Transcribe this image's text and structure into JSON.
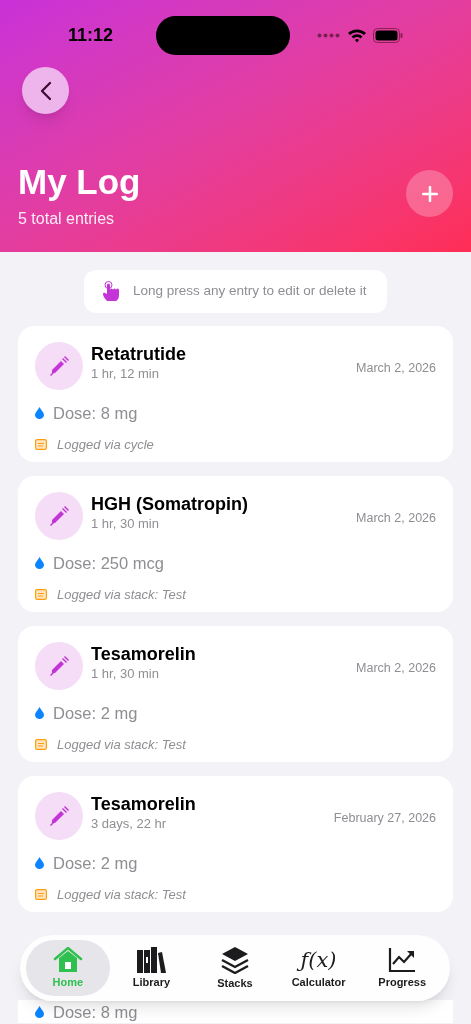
{
  "status_bar": {
    "time": "11:12"
  },
  "header": {
    "title": "My Log",
    "subtitle": "5 total entries"
  },
  "tip": "Long press any entry to edit or delete it",
  "entries": [
    {
      "name": "Retatrutide",
      "ago": "1 hr, 12 min",
      "date": "March 2, 2026",
      "dose": "Dose: 8 mg",
      "source": "Logged via cycle"
    },
    {
      "name": "HGH (Somatropin)",
      "ago": "1 hr, 30 min",
      "date": "March 2, 2026",
      "dose": "Dose: 250 mcg",
      "source": "Logged via stack: Test"
    },
    {
      "name": "Tesamorelin",
      "ago": "1 hr, 30 min",
      "date": "March 2, 2026",
      "dose": "Dose: 2 mg",
      "source": "Logged via stack: Test"
    },
    {
      "name": "Tesamorelin",
      "ago": "3 days, 22 hr",
      "date": "February 27, 2026",
      "dose": "Dose: 2 mg",
      "source": "Logged via stack: Test"
    },
    {
      "dose": "Dose: 8 mg"
    }
  ],
  "tabs": [
    {
      "kind": "home",
      "label": "Home",
      "selected": true
    },
    {
      "kind": "library",
      "label": "Library",
      "selected": false
    },
    {
      "kind": "stacks",
      "label": "Stacks",
      "selected": false
    },
    {
      "kind": "function",
      "glyph": "ƒ(x)",
      "label": "Calculator",
      "selected": false
    },
    {
      "kind": "progress",
      "label": "Progress",
      "selected": false
    }
  ]
}
